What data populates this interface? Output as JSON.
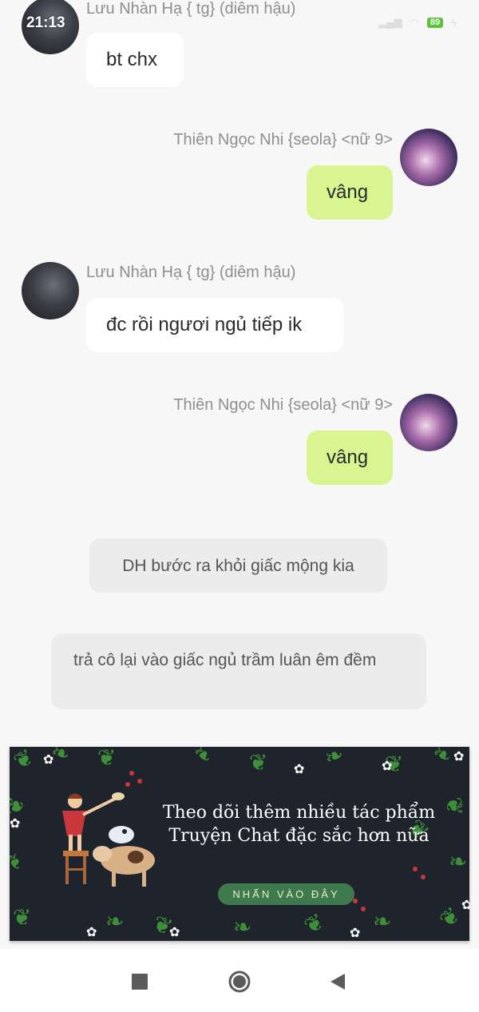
{
  "status_bar": {
    "time": "21:13",
    "battery": "89",
    "icons": [
      "signal-icon",
      "wifi-icon",
      "battery-icon",
      "charging-icon"
    ]
  },
  "messages": [
    {
      "sender": "Lưu Nhàn Hạ { tg} (diêm hậu)",
      "text": "bt chx",
      "side": "left"
    },
    {
      "sender": "Thiên Ngọc Nhi {seola} <nữ 9>",
      "text": "vâng",
      "side": "right"
    },
    {
      "sender": "Lưu Nhàn Hạ { tg} (diêm hậu)",
      "text": "đc rồi ngươi ngủ tiếp ik",
      "side": "left"
    },
    {
      "sender": "Thiên Ngọc Nhi {seola} <nữ 9>",
      "text": "vâng",
      "side": "right"
    }
  ],
  "narration": [
    {
      "text": "DH bước ra khỏi giấc mộng kia"
    },
    {
      "text": "trả cô lại vào giấc ngủ trầm luân êm đềm"
    }
  ],
  "banner": {
    "title": "Theo dõi thêm nhiều tác phẩm Truyện Chat đặc sắc hơn nữa",
    "cta": "NHẤN VÀO ĐÂY",
    "colors": {
      "background": "#1f232b",
      "leaf": "#3e8f3a",
      "cta": "#3f7a4e"
    }
  },
  "nav_bar": {
    "buttons": [
      "recent-apps-icon",
      "home-icon",
      "back-icon"
    ]
  },
  "colors": {
    "background": "#f7f7f7",
    "bubble_left": "#ffffff",
    "bubble_right": "#d8f592",
    "narration": "#ececec",
    "name": "#8f8f8f"
  }
}
